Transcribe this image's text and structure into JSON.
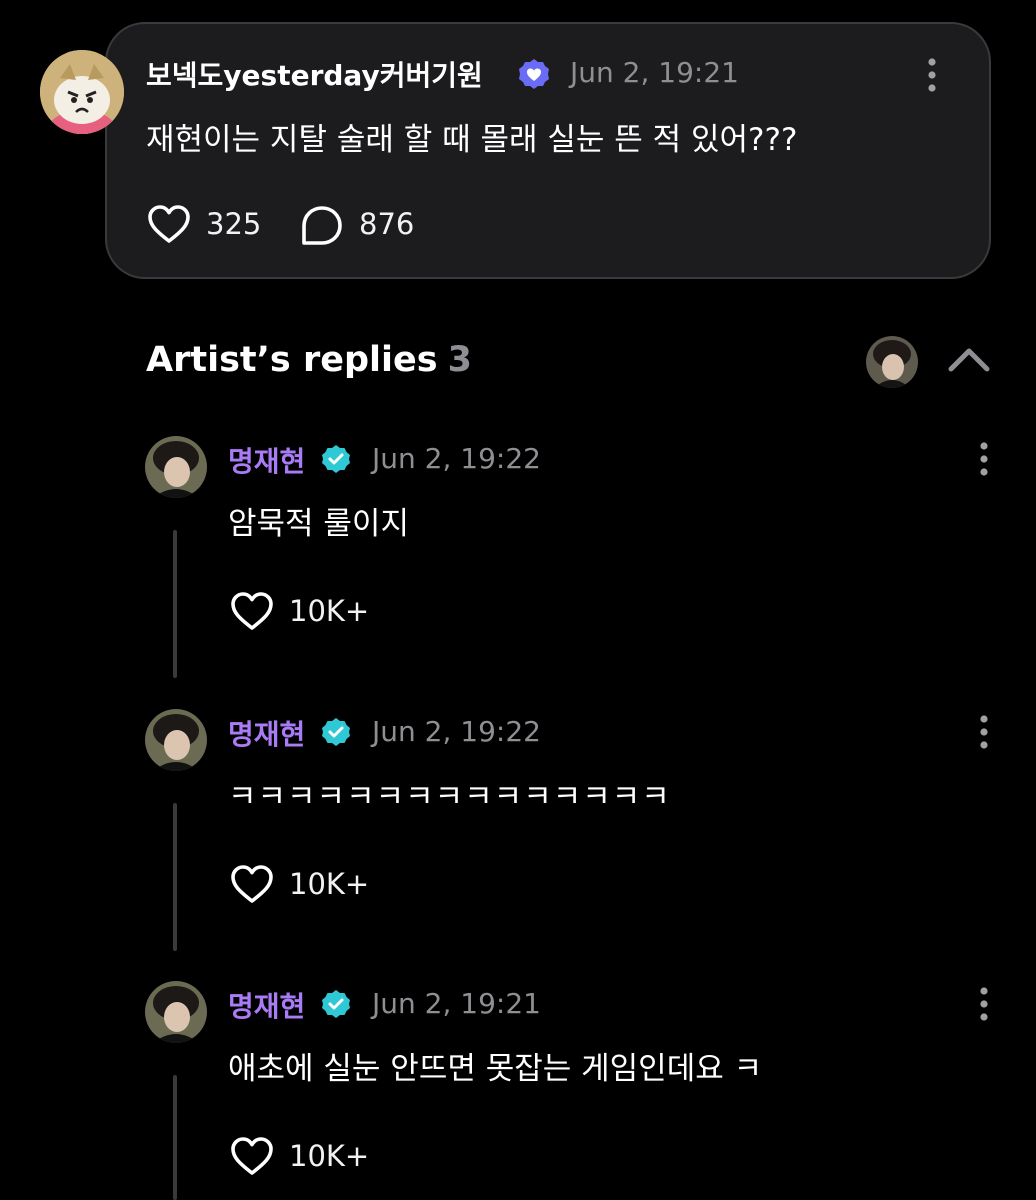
{
  "post": {
    "author": "보넥도yesterday커버기원",
    "timestamp": "Jun 2, 19:21",
    "body": "재현이는 지탈 술래 할 때 몰래 실눈 뜬 적 있어???",
    "likes": "325",
    "comments": "876"
  },
  "replies_header": {
    "title": "Artist’s replies",
    "count": "3"
  },
  "replies": [
    {
      "author": "명재현",
      "timestamp": "Jun 2, 19:22",
      "body": "암묵적 룰이지",
      "likes": "10K+"
    },
    {
      "author": "명재현",
      "timestamp": "Jun 2, 19:22",
      "body": "ㅋㅋㅋㅋㅋㅋㅋㅋㅋㅋㅋㅋㅋㅋㅋ",
      "likes": "10K+"
    },
    {
      "author": "명재현",
      "timestamp": "Jun 2, 19:21",
      "body": "애초에 실눈 안뜨면 못잡는 게임인데요 ㅋ",
      "likes": "10K+"
    }
  ],
  "colors": {
    "background": "#000000",
    "card": "#1c1c1e",
    "artist_name": "#a97cf5",
    "verified_teal": "#2fc9d6",
    "verified_fan": "#6b6cf5",
    "muted_text": "#8e8e93"
  },
  "icons": {
    "like": "heart-icon",
    "comment": "comment-bubble-icon",
    "more": "more-vertical-icon",
    "collapse": "chevron-up-icon",
    "badge": "verified-badge-icon"
  }
}
